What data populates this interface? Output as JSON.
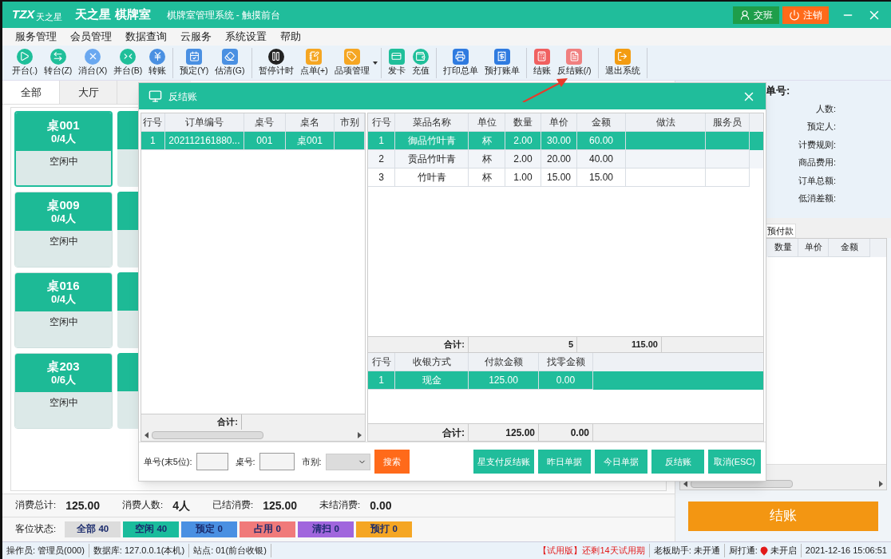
{
  "title_bar": {
    "logo_mark": "TZX",
    "logo_text": "天之星",
    "brand": "天之星 棋牌室",
    "subtitle": "棋牌室管理系统 - 触摸前台",
    "buttons": [
      {
        "label": "交班",
        "kind": "handover"
      },
      {
        "label": "注销",
        "kind": "logout"
      }
    ]
  },
  "menu": [
    "服务管理",
    "会员管理",
    "数据查询",
    "云服务",
    "系统设置",
    "帮助"
  ],
  "toolbar_groups": [
    [
      {
        "label": "开台(.)"
      },
      {
        "label": "转台(Z)"
      },
      {
        "label": "消台(X)"
      },
      {
        "label": "并台(B)"
      },
      {
        "label": "转账"
      }
    ],
    [
      {
        "label": "预定(Y)"
      },
      {
        "label": "估清(G)"
      }
    ],
    [
      {
        "label": "暂停计时"
      },
      {
        "label": "点单(+)"
      },
      {
        "label": "品项管理",
        "dropdown": true
      }
    ],
    [
      {
        "label": "发卡"
      },
      {
        "label": "充值"
      }
    ],
    [
      {
        "label": "打印总单"
      },
      {
        "label": "预打账单"
      }
    ],
    [
      {
        "label": "结账"
      },
      {
        "label": "反结账(/)"
      }
    ],
    [
      {
        "label": "退出系统"
      }
    ]
  ],
  "area_tabs": [
    {
      "label": "全部",
      "selected": true
    },
    {
      "label": "大厅",
      "selected": false
    }
  ],
  "tables": [
    {
      "name": "桌001",
      "guests": "0/4人",
      "status": "空闲中",
      "selected": true
    },
    {
      "name": "桌009",
      "guests": "0/4人",
      "status": "空闲中",
      "selected": false
    },
    {
      "name": "桌016",
      "guests": "0/4人",
      "status": "空闲中",
      "selected": false
    },
    {
      "name": "桌203",
      "guests": "0/6人",
      "status": "空闲中",
      "selected": false
    }
  ],
  "summary": [
    {
      "label": "消费总计:",
      "value": "125.00"
    },
    {
      "label": "消费人数:",
      "value": "4人"
    },
    {
      "label": "已结消费:",
      "value": "125.00"
    },
    {
      "label": "未结消费:",
      "value": "0.00"
    }
  ],
  "room_status": {
    "label": "客位状态:",
    "chips": [
      {
        "label": "全部 40",
        "color": "#dcdcdc"
      },
      {
        "label": "空闲 40",
        "color": "#1abc9c"
      },
      {
        "label": "预定 0",
        "color": "#4a90e2"
      },
      {
        "label": "占用 0",
        "color": "#f07a7a"
      },
      {
        "label": "清扫 0",
        "color": "#a066dd"
      },
      {
        "label": "预打 0",
        "color": "#f5a623"
      }
    ]
  },
  "order_panel": {
    "title": "单号:",
    "fields": [
      "人数:",
      "预定人:",
      "计费规则:",
      "商品费用:",
      "订单总额:",
      "低消差额:"
    ],
    "tab": "预付款",
    "columns": [
      "数量",
      "单价",
      "金额"
    ],
    "checkout": "结账"
  },
  "status_bar": {
    "left": [
      "操作员: 管理员(000)",
      "数据库: 127.0.0.1(本机)",
      "站点: 01(前台收银)"
    ],
    "trial": "【试用版】还剩14天试用期",
    "boss": "老板助手: 未开通",
    "kitchen_label": "厨打通:",
    "kitchen_state": "未开启",
    "datetime": "2021-12-16 15:06:51"
  },
  "dialog": {
    "title": "反结账",
    "orders": {
      "columns": [
        "行号",
        "订单编号",
        "桌号",
        "桌名",
        "市别"
      ],
      "rows": [
        {
          "cells": [
            "1",
            "202112161880...",
            "001",
            "桌001"
          ],
          "selected": true
        }
      ],
      "total_label": "合计:"
    },
    "items": {
      "columns": [
        "行号",
        "菜品名称",
        "单位",
        "数量",
        "单价",
        "金额",
        "做法",
        "服务员"
      ],
      "rows": [
        {
          "cells": [
            "1",
            "御品竹叶青",
            "杯",
            "2.00",
            "30.00",
            "60.00"
          ],
          "selected": true
        },
        {
          "cells": [
            "2",
            "贡品竹叶青",
            "杯",
            "2.00",
            "20.00",
            "40.00"
          ],
          "selected": false
        },
        {
          "cells": [
            "3",
            "竹叶青",
            "杯",
            "1.00",
            "15.00",
            "15.00"
          ],
          "selected": false
        }
      ],
      "total": {
        "label": "合计:",
        "quantity": "5",
        "amount": "115.00"
      }
    },
    "payments": {
      "columns": [
        "行号",
        "收银方式",
        "付款金额",
        "找零金额"
      ],
      "rows": [
        {
          "cells": [
            "1",
            "现金",
            "125.00",
            "0.00"
          ],
          "selected": true
        }
      ],
      "total": {
        "label": "合计:",
        "paid": "125.00",
        "change": "0.00"
      }
    },
    "search": {
      "order_label": "单号(末5位):",
      "table_label": "桌号:",
      "market_label": "市别:",
      "button": "搜索"
    },
    "actions": [
      "星支付反结账",
      "昨日单据",
      "今日单据",
      "反结账",
      "取消(ESC)"
    ]
  }
}
